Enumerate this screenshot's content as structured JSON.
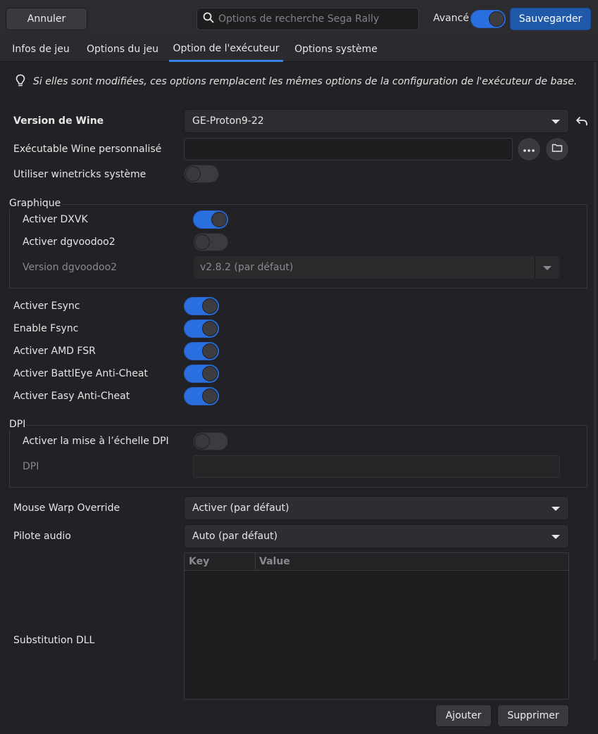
{
  "header": {
    "cancel_label": "Annuler",
    "search_placeholder": "Options de recherche Sega Rally",
    "advanced_label": "Avancé",
    "advanced_on": true,
    "save_label": "Sauvegarder"
  },
  "tabs": [
    {
      "label": "Infos de jeu",
      "active": false
    },
    {
      "label": "Options du jeu",
      "active": false
    },
    {
      "label": "Option de l'exécuteur",
      "active": true
    },
    {
      "label": "Options système",
      "active": false
    }
  ],
  "info_text": "Si elles sont modifiées, ces options remplacent les mêmes options de la configuration de l'exécuteur de base.",
  "wine_version": {
    "label": "Version de Wine",
    "value": "GE-Proton9-22"
  },
  "custom_exe": {
    "label": "Exécutable Wine personnalisé",
    "value": ""
  },
  "winetricks": {
    "label": "Utiliser winetricks système",
    "on": false
  },
  "graphics": {
    "title": "Graphique",
    "dxvk": {
      "label": "Activer DXVK",
      "on": true
    },
    "dgvoodoo2": {
      "label": "Activer dgvoodoo2",
      "on": false
    },
    "dgvoodoo2_version": {
      "label": "Version dgvoodoo2",
      "value": "v2.8.2 (par défaut)"
    }
  },
  "toggles": [
    {
      "label": "Activer Esync",
      "on": true
    },
    {
      "label": "Enable Fsync",
      "on": true
    },
    {
      "label": "Activer AMD FSR",
      "on": true
    },
    {
      "label": "Activer BattlEye Anti-Cheat",
      "on": true
    },
    {
      "label": "Activer Easy Anti-Cheat",
      "on": true
    }
  ],
  "dpi": {
    "title": "DPI",
    "scaling": {
      "label": "Activer la mise à l’échelle DPI",
      "on": false
    },
    "value": {
      "label": "DPI",
      "value": ""
    }
  },
  "mouse_warp": {
    "label": "Mouse Warp Override",
    "value": "Activer (par défaut)"
  },
  "audio_driver": {
    "label": "Pilote audio",
    "value": "Auto (par défaut)"
  },
  "dll": {
    "label": "Substitution DLL",
    "columns": [
      "Key",
      "Value"
    ],
    "add_label": "Ajouter",
    "remove_label": "Supprimer"
  }
}
